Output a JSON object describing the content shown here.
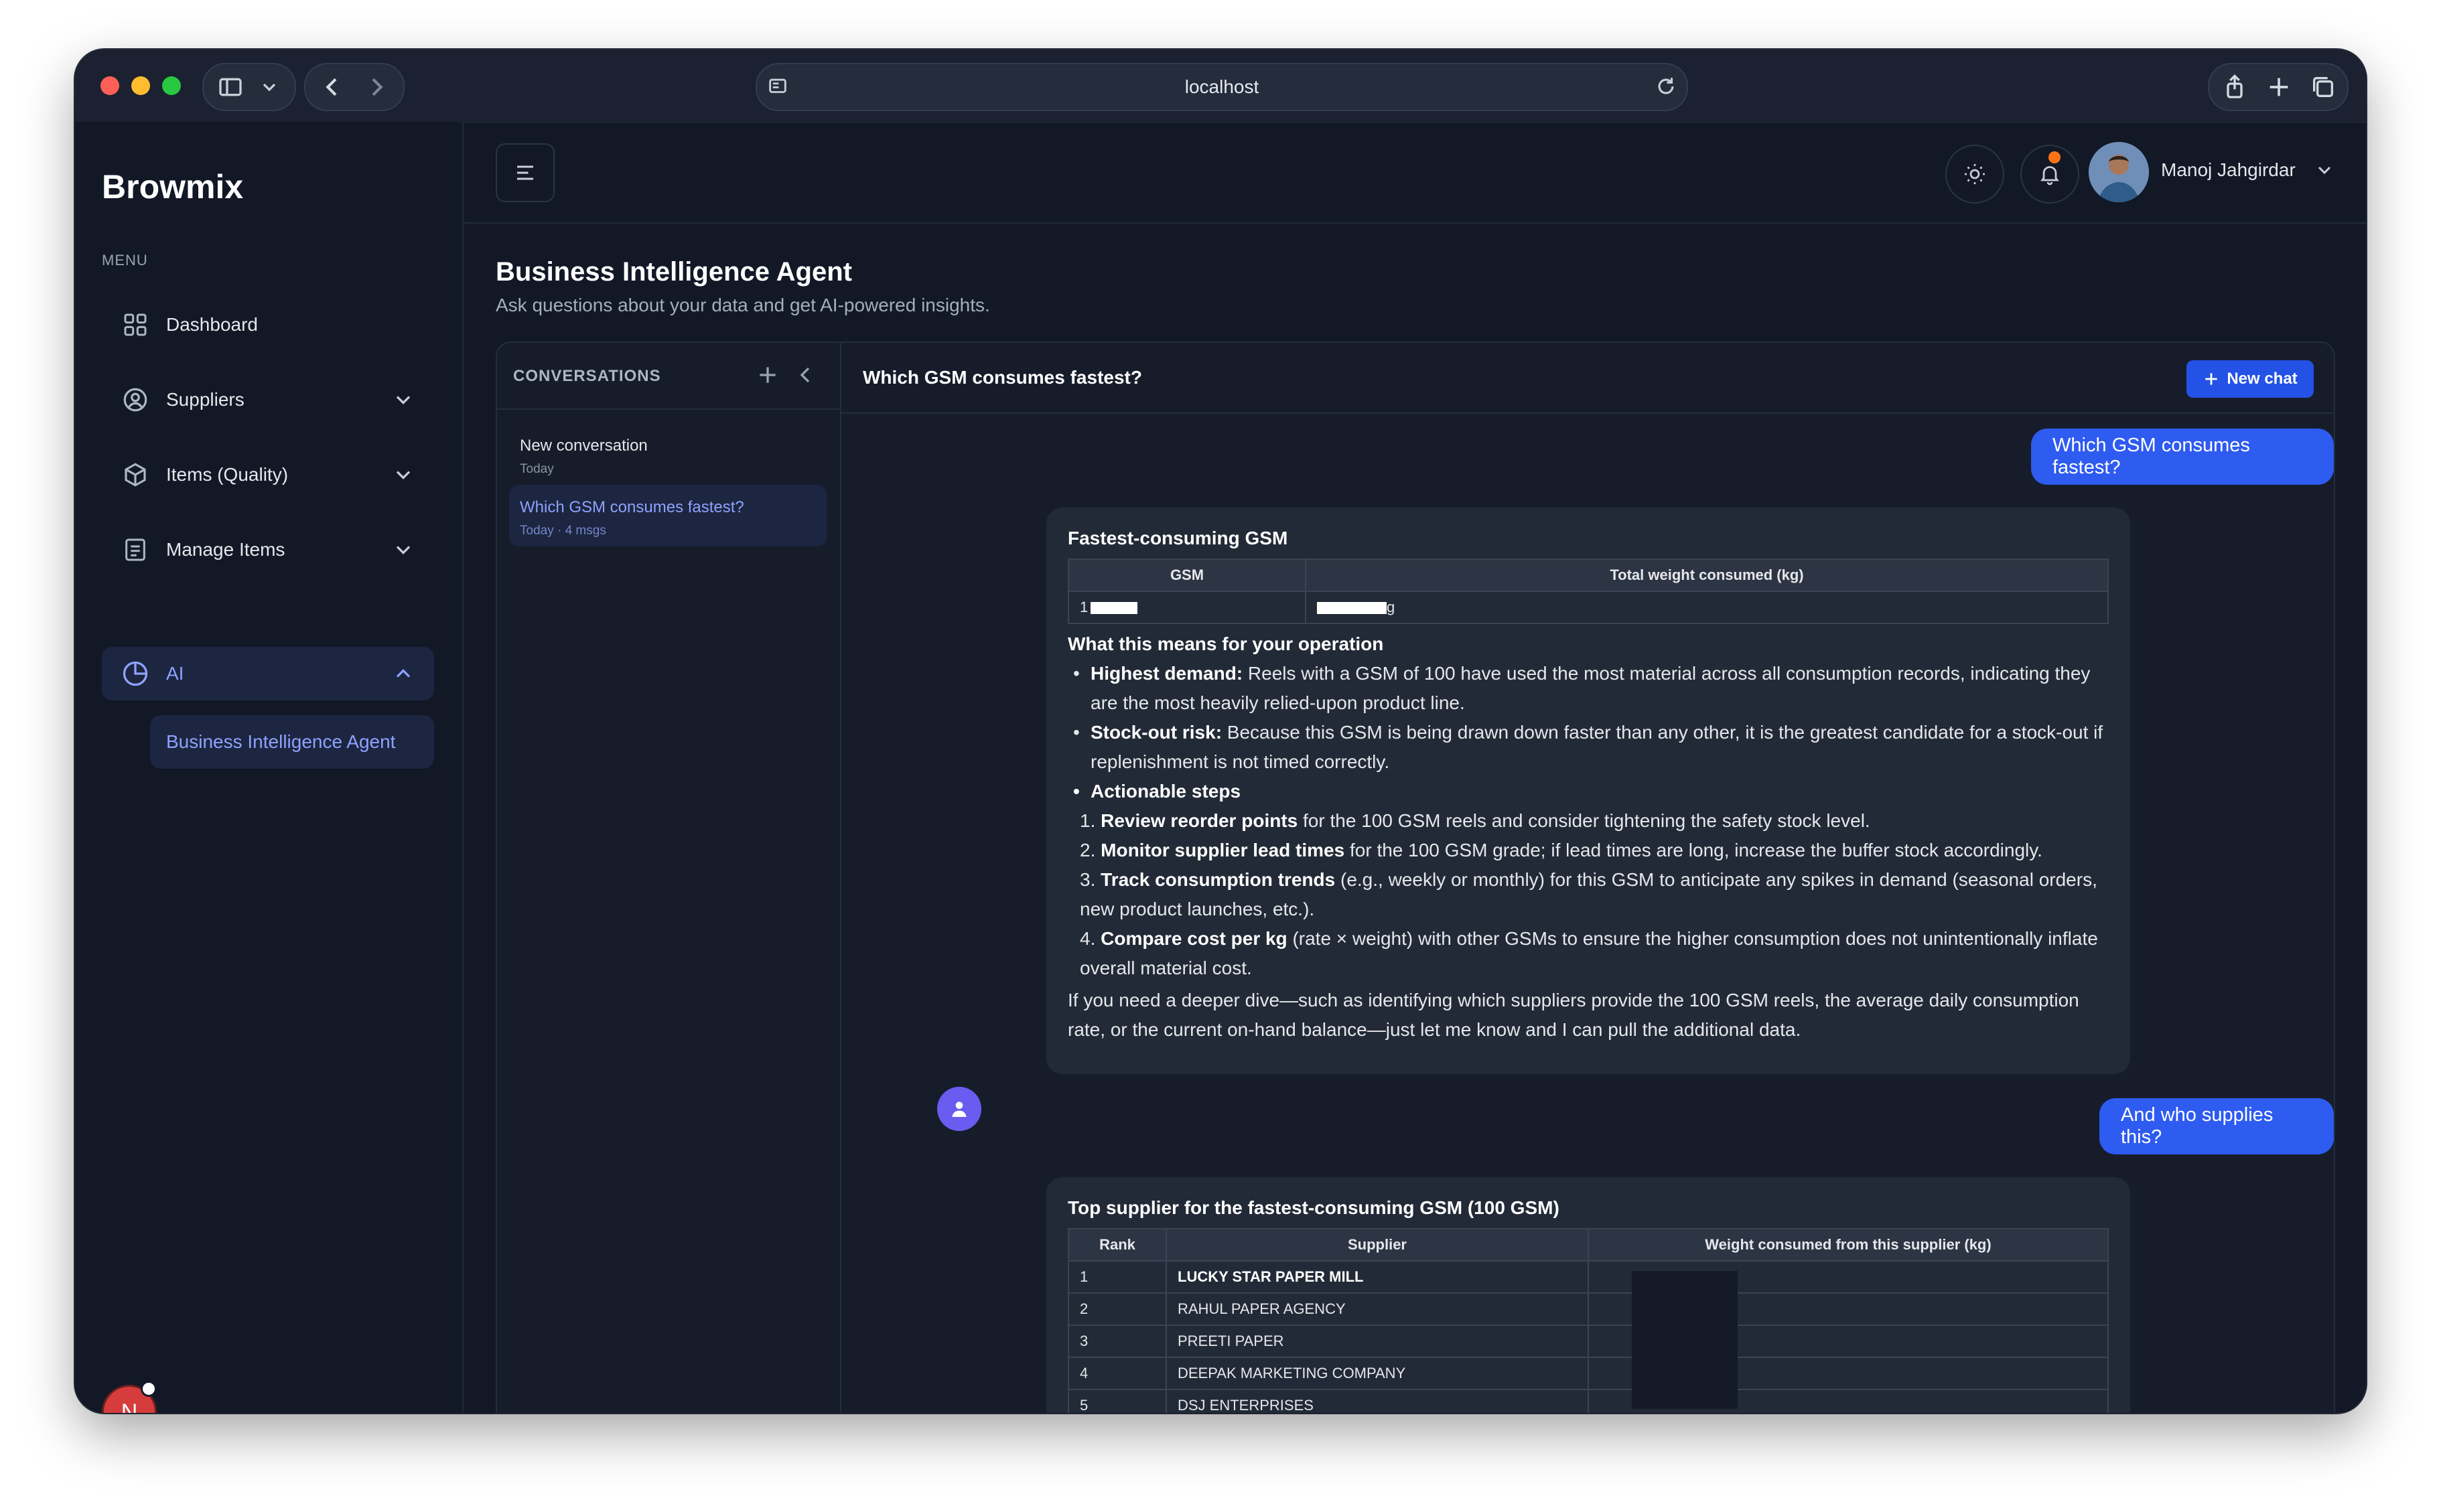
{
  "browser": {
    "url": "localhost"
  },
  "sidebar": {
    "brand": "Browmix",
    "menu_label": "MENU",
    "ai_label": "AI",
    "items": [
      {
        "label": "Dashboard",
        "icon": "grid-icon"
      },
      {
        "label": "Suppliers",
        "icon": "user-circle-icon"
      },
      {
        "label": "Items (Quality)",
        "icon": "box-icon"
      },
      {
        "label": "Manage Items",
        "icon": "list-icon"
      },
      {
        "label": "AI",
        "icon": "pie-chart-icon"
      }
    ],
    "sub_item": "Business Intelligence Agent",
    "avatar_initial": "N"
  },
  "header": {
    "user_name": "Manoj Jahgirdar"
  },
  "page": {
    "title": "Business Intelligence Agent",
    "subtitle": "Ask questions about your data and get AI-powered insights."
  },
  "conversations": {
    "heading": "CONVERSATIONS",
    "items": [
      {
        "title": "New conversation",
        "meta": "Today"
      },
      {
        "title": "Which GSM consumes fastest?",
        "meta": "Today · 4 msgs"
      }
    ]
  },
  "chat": {
    "title": "Which GSM consumes fastest?",
    "new_chat_label": "New chat",
    "user_msg_1": "Which GSM consumes fastest?",
    "user_msg_2": "And who supplies this?",
    "answer1": {
      "heading": "Fastest-consuming GSM",
      "table_headers": [
        "GSM",
        "Total weight consumed (kg)"
      ],
      "row_gsm": "1",
      "row_weight_suffix": "g",
      "subheading": "What this means for your operation",
      "b1_label": "Highest demand:",
      "b1_text": " Reels with a GSM of 100 have used the most material across all consumption records, indicating they are the most heavily relied-upon product line.",
      "b2_label": "Stock-out risk:",
      "b2_text": " Because this GSM is being drawn down faster than any other, it is the greatest candidate for a stock-out if replenishment is not timed correctly.",
      "b3_label": "Actionable steps",
      "steps": [
        {
          "n": "1.",
          "label": "Review reorder points",
          "text": " for the 100 GSM reels and consider tightening the safety stock level."
        },
        {
          "n": "2.",
          "label": "Monitor supplier lead times",
          "text": " for the 100 GSM grade; if lead times are long, increase the buffer stock accordingly."
        },
        {
          "n": "3.",
          "label": "Track consumption trends",
          "text": " (e.g., weekly or monthly) for this GSM to anticipate any spikes in demand (seasonal orders, new product launches, etc.)."
        },
        {
          "n": "4.",
          "label": "Compare cost per kg",
          "text": " (rate × weight) with other GSMs to ensure the higher consumption does not unintentionally inflate overall material cost."
        }
      ],
      "closing": "If you need a deeper dive—such as identifying which suppliers provide the 100 GSM reels, the average daily consumption rate, or the current on-hand balance—just let me know and I can pull the additional data."
    },
    "answer2": {
      "heading": "Top supplier for the fastest-consuming GSM (100 GSM)",
      "table_headers": [
        "Rank",
        "Supplier",
        "Weight consumed from this supplier (kg)"
      ],
      "rows": [
        {
          "rank": "1",
          "supplier": "LUCKY STAR PAPER MILL"
        },
        {
          "rank": "2",
          "supplier": "RAHUL PAPER AGENCY"
        },
        {
          "rank": "3",
          "supplier": "PREETI PAPER"
        },
        {
          "rank": "4",
          "supplier": "DEEPAK MARKETING COMPANY"
        },
        {
          "rank": "5",
          "supplier": "DSJ ENTERPRISES"
        }
      ]
    }
  },
  "colors": {
    "accent": "#2e5bf0",
    "active_bg": "#1c2640",
    "active_text": "#8ea2ff",
    "background": "#121826"
  }
}
